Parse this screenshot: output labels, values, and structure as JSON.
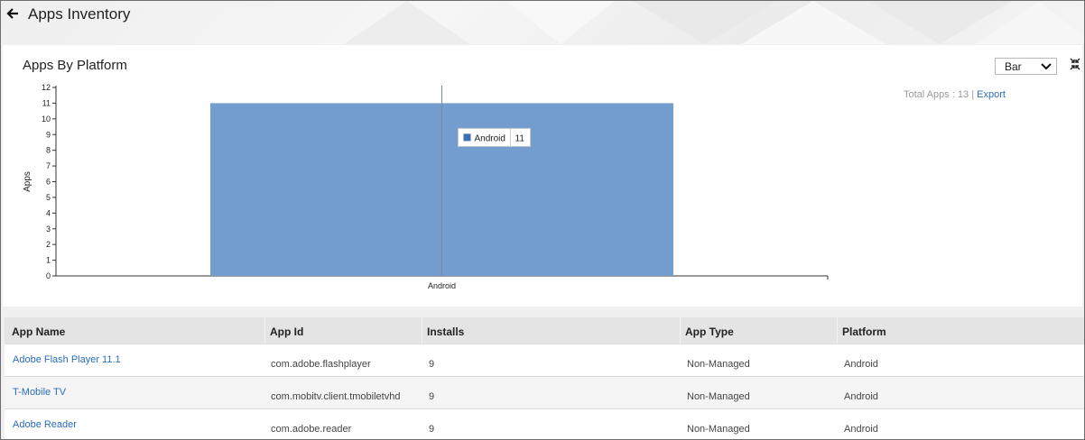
{
  "page": {
    "title": "Apps Inventory"
  },
  "panel": {
    "title": "Apps By Platform",
    "chart_type_select": "Bar",
    "total_label": "Total Apps : 13 |",
    "export_label": "Export"
  },
  "chart_data": {
    "type": "bar",
    "categories": [
      "Android"
    ],
    "values": [
      11
    ],
    "ylabel": "Apps",
    "xlabel": "",
    "ylim": [
      0,
      12
    ],
    "yticks": [
      "0",
      "1",
      "2",
      "3",
      "4",
      "5",
      "6",
      "7",
      "8",
      "9",
      "10",
      "11",
      "12"
    ],
    "tooltip": {
      "label": "Android",
      "value": "11"
    },
    "colors": {
      "bar": "#739dcf",
      "tooltip_swatch": "#3c6fb3"
    }
  },
  "table": {
    "columns": [
      "App Name",
      "App Id",
      "Installs",
      "App Type",
      "Platform"
    ],
    "rows": [
      {
        "name": "Adobe Flash Player 11.1",
        "id": "com.adobe.flashplayer",
        "installs": "9",
        "type": "Non-Managed",
        "platform": "Android"
      },
      {
        "name": "T-Mobile TV",
        "id": "com.mobitv.client.tmobiletvhd",
        "installs": "9",
        "type": "Non-Managed",
        "platform": "Android"
      },
      {
        "name": "Adobe Reader",
        "id": "com.adobe.reader",
        "installs": "9",
        "type": "Non-Managed",
        "platform": "Android"
      }
    ]
  }
}
